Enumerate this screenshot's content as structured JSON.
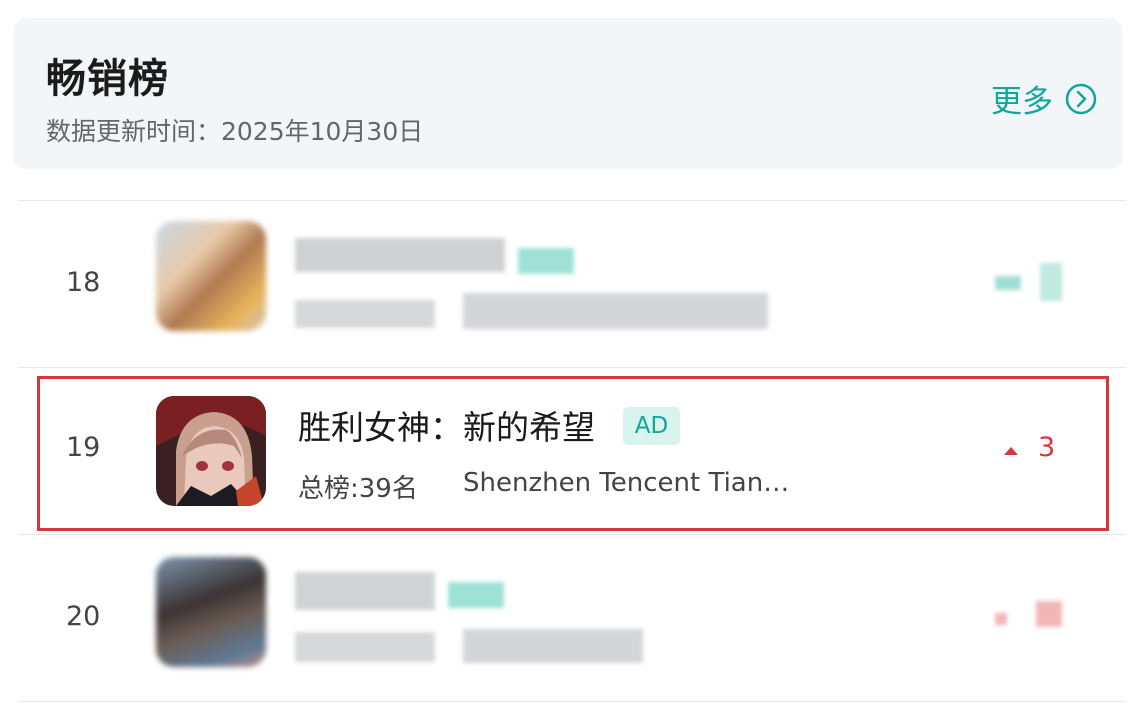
{
  "header": {
    "title": "畅销榜",
    "updated": "数据更新时间：2025年10月30日",
    "more_label": "更多"
  },
  "rows": [
    {
      "rank": "18"
    },
    {
      "rank": "19",
      "app_name": "胜利女神：新的希望",
      "badge": "AD",
      "overall_rank": "总榜:39名",
      "developer": "Shenzhen Tencent Tian…",
      "change": "3",
      "change_direction": "up"
    },
    {
      "rank": "20"
    }
  ],
  "colors": {
    "accent": "#12a59a",
    "highlight_border": "#d9363b",
    "trend_up": "#d9363b"
  }
}
